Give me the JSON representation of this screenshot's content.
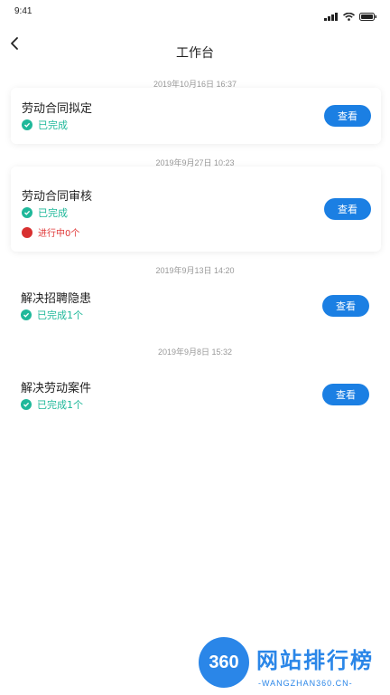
{
  "status_bar": {
    "time": "9:41",
    "icons": [
      "signal-icon",
      "wifi-icon",
      "battery-icon"
    ]
  },
  "nav": {
    "back_icon": "chevron-left-icon",
    "title": "工作台"
  },
  "entries": [
    {
      "timestamp": "2019年10月16日 16:37",
      "title": "劳动合同拟定",
      "statuses": [
        {
          "kind": "done",
          "text": "已完成"
        }
      ],
      "button": "查看"
    },
    {
      "timestamp": "2019年9月27日 10:23",
      "title": "劳动合同审核",
      "statuses": [
        {
          "kind": "done",
          "text": "已完成"
        },
        {
          "kind": "progress",
          "text": "进行中0个"
        }
      ],
      "button": "查看"
    },
    {
      "timestamp": "2019年9月13日 14:20",
      "title": "解决招聘隐患",
      "statuses": [
        {
          "kind": "done",
          "text": "已完成1个"
        }
      ],
      "button": "查看"
    },
    {
      "timestamp": "2019年9月8日 15:32",
      "title": "解决劳动案件",
      "statuses": [
        {
          "kind": "done",
          "text": "已完成1个"
        }
      ],
      "button": "查看"
    }
  ],
  "watermark": {
    "logo_text": "360",
    "title": "网站排行榜",
    "subtitle": "-WANGZHAN360.CN-"
  },
  "colors": {
    "accent": "#1b7fe3",
    "done": "#1fb89a",
    "progress": "#d83030",
    "watermark": "#2a86e8"
  }
}
